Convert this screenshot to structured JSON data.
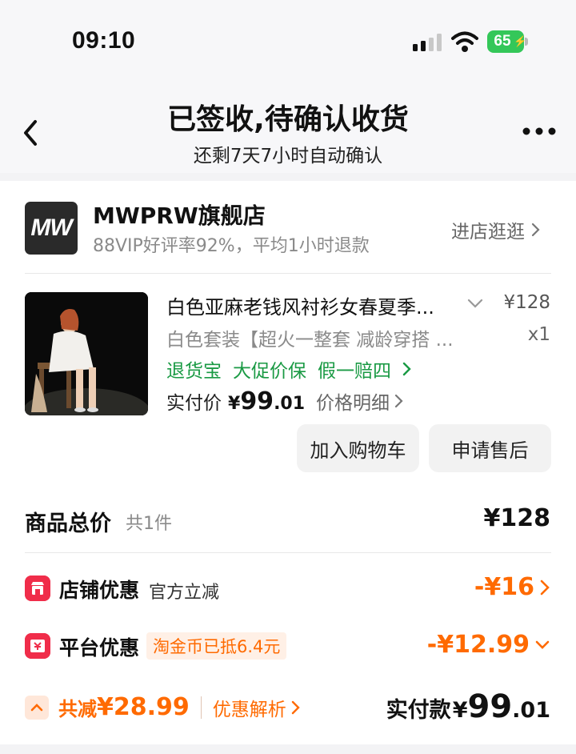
{
  "status_bar": {
    "time": "09:10",
    "battery": "65"
  },
  "header": {
    "title": "已签收,待确认收货",
    "subtitle": "还剩7天7小时自动确认"
  },
  "shop": {
    "logo_text": "MW",
    "name": "MWPRW旗舰店",
    "desc": "88VIP好评率92%，平均1小时退款",
    "enter_label": "进店逛逛"
  },
  "product": {
    "title": "白色亚麻老钱风衬衫女春夏季...",
    "price": "¥128",
    "spec": "白色套装【超火一整套 减龄穿搭 ...",
    "qty": "x1",
    "tags": [
      "退货宝",
      "大促价保",
      "假一赔四"
    ],
    "pay_label": "实付价",
    "pay_currency": "¥",
    "pay_int": "99",
    "pay_dec": ".01",
    "price_detail_label": "价格明细"
  },
  "actions": {
    "add_cart": "加入购物车",
    "after_sale": "申请售后"
  },
  "summary": {
    "label": "商品总价",
    "count": "共1件",
    "price": "¥128",
    "store_discount_label": "店铺优惠",
    "store_discount_note": "官方立减",
    "store_discount_amount": "-¥16",
    "platform_discount_label": "平台优惠",
    "platform_discount_badge": "淘金币已抵6.4元",
    "platform_discount_amount": "-¥12.99",
    "saved_label": "共减",
    "saved_amount": "¥28.99",
    "analysis_label": "优惠解析",
    "final_label": "实付款",
    "final_currency": "¥",
    "final_int": "99",
    "final_dec": ".01"
  },
  "colors": {
    "accent_orange": "#ff6a00",
    "green_tag": "#1a9a44",
    "discount_icon": "#f02d4a"
  }
}
